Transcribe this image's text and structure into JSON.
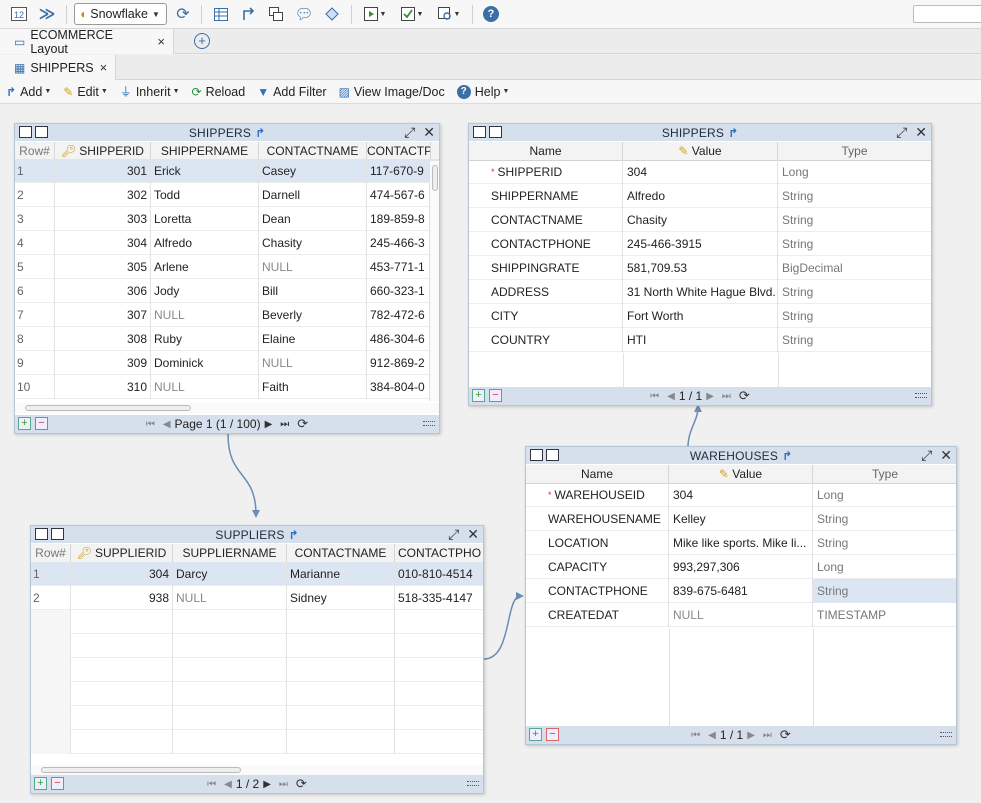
{
  "top_toolbar": {
    "connection": "Snowflake",
    "icons": [
      "sql-console-icon",
      "forward-icon",
      "refresh-icon",
      "table-icon",
      "jump-icon",
      "layout-icon",
      "comment-icon",
      "shape-icon",
      "run-icon",
      "validate-icon",
      "query-icon",
      "help-icon"
    ]
  },
  "layout_tab": {
    "label": "ECOMMERCE Layout",
    "close": "×"
  },
  "table_tab": {
    "label": "SHIPPERS",
    "close": "×"
  },
  "actions": {
    "add": "Add",
    "edit": "Edit",
    "inherit": "Inherit",
    "reload": "Reload",
    "add_filter": "Add Filter",
    "view_image": "View Image/Doc",
    "help": "Help"
  },
  "shippers_grid": {
    "title": "SHIPPERS",
    "columns": [
      "Row#",
      "SHIPPERID",
      "SHIPPERNAME",
      "CONTACTNAME",
      "CONTACTP"
    ],
    "rows": [
      [
        "1",
        "301",
        "Erick",
        "Casey",
        "117-670-9"
      ],
      [
        "2",
        "302",
        "Todd",
        "Darnell",
        "474-567-6"
      ],
      [
        "3",
        "303",
        "Loretta",
        "Dean",
        "189-859-8"
      ],
      [
        "4",
        "304",
        "Alfredo",
        "Chasity",
        "245-466-3"
      ],
      [
        "5",
        "305",
        "Arlene",
        "NULL",
        "453-771-1"
      ],
      [
        "6",
        "306",
        "Jody",
        "Bill",
        "660-323-1"
      ],
      [
        "7",
        "307",
        "NULL",
        "Beverly",
        "782-472-6"
      ],
      [
        "8",
        "308",
        "Ruby",
        "Elaine",
        "486-304-6"
      ],
      [
        "9",
        "309",
        "Dominick",
        "NULL",
        "912-869-2"
      ],
      [
        "10",
        "310",
        "NULL",
        "Faith",
        "384-804-0"
      ]
    ],
    "pager": "Page 1 (1 / 100)"
  },
  "shippers_record": {
    "title": "SHIPPERS",
    "columns": [
      "Name",
      "Value",
      "Type"
    ],
    "rows": [
      [
        "SHIPPERID",
        "304",
        "Long"
      ],
      [
        "SHIPPERNAME",
        "Alfredo",
        "String"
      ],
      [
        "CONTACTNAME",
        "Chasity",
        "String"
      ],
      [
        "CONTACTPHONE",
        "245-466-3915",
        "String"
      ],
      [
        "SHIPPINGRATE",
        "581,709.53",
        "BigDecimal"
      ],
      [
        "ADDRESS",
        "31 North White Hague Blvd.",
        "String"
      ],
      [
        "CITY",
        "Fort Worth",
        "String"
      ],
      [
        "COUNTRY",
        "HTI",
        "String"
      ]
    ],
    "pager": "1 / 1"
  },
  "suppliers_grid": {
    "title": "SUPPLIERS",
    "columns": [
      "Row#",
      "SUPPLIERID",
      "SUPPLIERNAME",
      "CONTACTNAME",
      "CONTACTPHO"
    ],
    "rows": [
      [
        "1",
        "304",
        "Darcy",
        "Marianne",
        "010-810-4514"
      ],
      [
        "2",
        "938",
        "NULL",
        "Sidney",
        "518-335-4147"
      ]
    ],
    "pager": "1 / 2"
  },
  "warehouses_record": {
    "title": "WAREHOUSES",
    "columns": [
      "Name",
      "Value",
      "Type"
    ],
    "rows": [
      [
        "WAREHOUSEID",
        "304",
        "Long"
      ],
      [
        "WAREHOUSENAME",
        "Kelley",
        "String"
      ],
      [
        "LOCATION",
        "Mike like sports. Mike li...",
        "String"
      ],
      [
        "CAPACITY",
        "993,297,306",
        "Long"
      ],
      [
        "CONTACTPHONE",
        "839-675-6481",
        "String"
      ],
      [
        "CREATEDAT",
        "NULL",
        "TIMESTAMP"
      ]
    ],
    "pager": "1 / 1"
  }
}
